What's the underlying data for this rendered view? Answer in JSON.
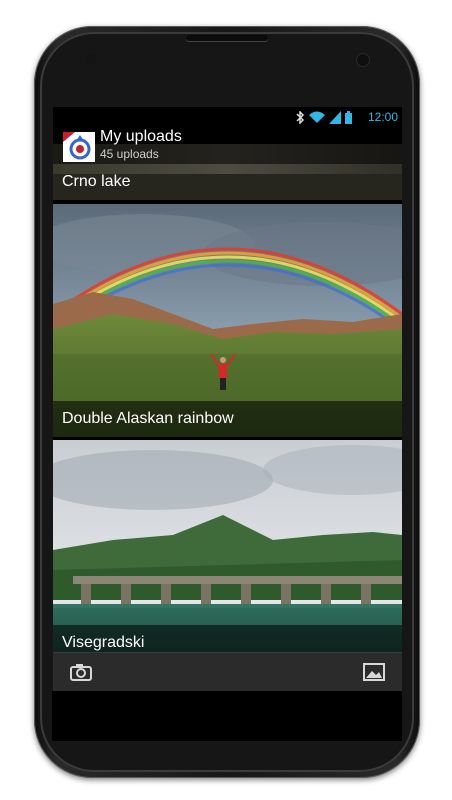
{
  "status": {
    "time": "12:00",
    "icons": [
      "bluetooth-icon",
      "wifi-icon",
      "signal-icon",
      "battery-icon"
    ],
    "accent": "#33b5e5"
  },
  "actionbar": {
    "title": "My uploads",
    "subtitle": "45 uploads",
    "icon": "commons-logo-icon"
  },
  "uploads": [
    {
      "title": "Crno lake"
    },
    {
      "title": "Double Alaskan rainbow"
    },
    {
      "title": "Visegradski"
    }
  ],
  "bottombar": {
    "left_icon": "camera-icon",
    "right_icon": "gallery-icon"
  }
}
